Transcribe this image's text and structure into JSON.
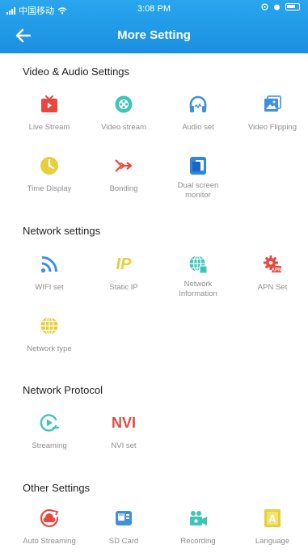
{
  "status_bar": {
    "carrier": "中国移动",
    "time": "3:08 PM"
  },
  "header": {
    "title": "More Setting"
  },
  "sections": [
    {
      "title": "Video & Audio Settings",
      "items": [
        {
          "label": "Live Stream",
          "icon": "tv-icon",
          "color": "#e8473f"
        },
        {
          "label": "Video stream",
          "icon": "film-reel-icon",
          "color": "#3cc6b8"
        },
        {
          "label": "Audio set",
          "icon": "headphones-icon",
          "color": "#3d8fe0"
        },
        {
          "label": "Video Flipping",
          "icon": "image-flip-icon",
          "color": "#3d8fe0"
        },
        {
          "label": "Time Display",
          "icon": "clock-icon",
          "color": "#e6cf39"
        },
        {
          "label": "Bonding",
          "icon": "bonding-arrows-icon",
          "color": "#e8473f"
        },
        {
          "label": "Dual screen\nmonitor",
          "icon": "dual-screen-icon",
          "color": "#2f86de"
        }
      ]
    },
    {
      "title": "Network settings",
      "items": [
        {
          "label": "WIFI set",
          "icon": "wifi-icon",
          "color": "#3d8fe0"
        },
        {
          "label": "Static IP",
          "icon": "ip-text-icon",
          "text": "IP",
          "color": "#e6cf39"
        },
        {
          "label": "Network\nInformation",
          "icon": "globe-grid-icon",
          "color": "#3cc6b8"
        },
        {
          "label": "APN Set",
          "icon": "apn-gear-icon",
          "color": "#e8473f"
        },
        {
          "label": "Network type",
          "icon": "globe-icon",
          "color": "#e6cf39"
        }
      ]
    },
    {
      "title": "Network Protocol",
      "items": [
        {
          "label": "Streaming",
          "icon": "streaming-play-icon",
          "color": "#3cc6b8"
        },
        {
          "label": "NVI set",
          "icon": "nvi-text-icon",
          "text": "NVI",
          "color": "#e8473f"
        }
      ]
    },
    {
      "title": "Other Settings",
      "items": [
        {
          "label": "Auto Streaming",
          "icon": "auto-stream-icon",
          "color": "#e8473f"
        },
        {
          "label": "SD Card",
          "icon": "sd-card-icon",
          "color": "#3d8fe0"
        },
        {
          "label": "Recording",
          "icon": "camera-recording-icon",
          "color": "#3cc6b8"
        },
        {
          "label": "Language",
          "icon": "language-icon",
          "text": "A",
          "color": "#e6cf39"
        }
      ]
    }
  ]
}
